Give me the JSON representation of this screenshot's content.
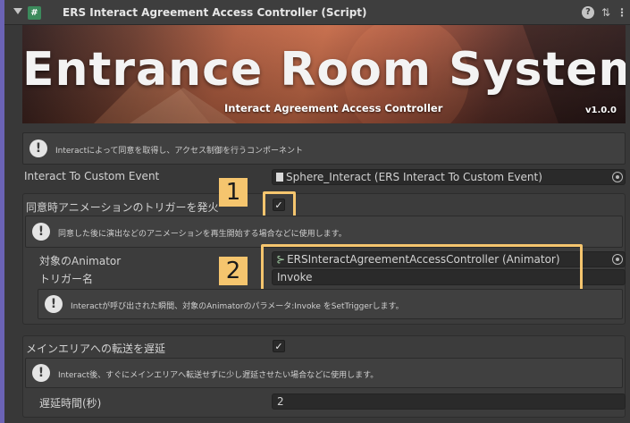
{
  "header": {
    "title": "ERS Interact Agreement Access Controller (Script)",
    "script_icon": "#",
    "icons": {
      "foldout": "chevron-down-icon",
      "help": "help-icon",
      "presets": "sliders-icon",
      "menu": "kebab-menu-icon"
    },
    "help_glyph": "?",
    "presets_glyph": "⇅",
    "menu_glyph": "⋮"
  },
  "banner": {
    "title": "Entrance Room System",
    "subtitle": "Interact Agreement Access Controller",
    "version": "v1.0.0"
  },
  "help_icon_glyph": "!",
  "intro_help": "Interactによって同意を取得し、アクセス制御を行うコンポーネント",
  "custom_event": {
    "label": "Interact To Custom Event",
    "value": "Sphere_Interact (ERS Interact To Custom Event)"
  },
  "animation": {
    "label": "同意時アニメーションのトリガーを発火",
    "checked": "✓",
    "help": "同意した後に演出などのアニメーションを再生開始する場合などに使用します。",
    "animator_label": "対象のAnimator",
    "animator_icon": "⊱",
    "animator_value": "ERSInteractAgreementAccessController (Animator)",
    "trigger_label": "トリガー名",
    "trigger_value": "Invoke",
    "trigger_help": "Interactが呼び出された瞬間、対象のAnimatorのパラメータ:Invoke をSetTriggerします。"
  },
  "delay": {
    "label": "メインエリアへの転送を遅延",
    "checked": "✓",
    "help": "Interact後、すぐにメインエリアへ転送せずに少し遅延させたい場合などに使用します。",
    "time_label": "遅延時間(秒)",
    "time_value": "2"
  },
  "badges": {
    "one": "1",
    "two": "2"
  },
  "colors": {
    "badge": "#f5c56e",
    "accent_bar": "#6b63b5",
    "script_icon": "#3c8a5c"
  }
}
